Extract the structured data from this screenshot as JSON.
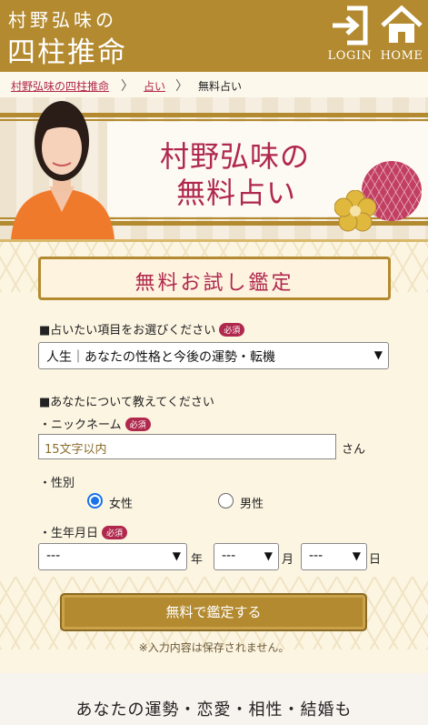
{
  "header": {
    "logo_line1": "村野弘味の",
    "logo_line2": "四柱推命",
    "login_label": "LOGIN",
    "home_label": "HOME"
  },
  "breadcrumb": {
    "home": "村野弘味の四柱推命",
    "sep1": "〉",
    "category": "占い",
    "sep2": "〉",
    "current": "無料占い"
  },
  "hero": {
    "title_line1": "村野弘味の",
    "title_line2": "無料占い"
  },
  "form": {
    "plate_title": "無料お試し鑑定",
    "required_badge": "必須",
    "item_label": "■占いたい項目をお選びください",
    "item_selected": "人生｜あなたの性格と今後の運勢・転機",
    "about_label": "■あなたについて教えてください",
    "nickname_label": "・ニックネーム",
    "nickname_placeholder": "15文字以内",
    "nickname_suffix": "さん",
    "gender_label": "・性別",
    "gender_female": "女性",
    "gender_male": "男性",
    "gender_selected": "女性",
    "birth_label": "・生年月日",
    "year_value": "---",
    "year_unit": "年",
    "month_value": "---",
    "month_unit": "月",
    "day_value": "---",
    "day_unit": "日",
    "submit_label": "無料で鑑定する",
    "note": "※入力内容は保存されません。"
  },
  "footer": {
    "tagline": "あなたの運勢・恋愛・相性・結婚も"
  },
  "colors": {
    "gold": "#b38a2f",
    "accent_red": "#b0284d",
    "radio_blue": "#1a73e8"
  },
  "icons": {
    "login": "login-arrow-icon",
    "home": "home-icon"
  }
}
